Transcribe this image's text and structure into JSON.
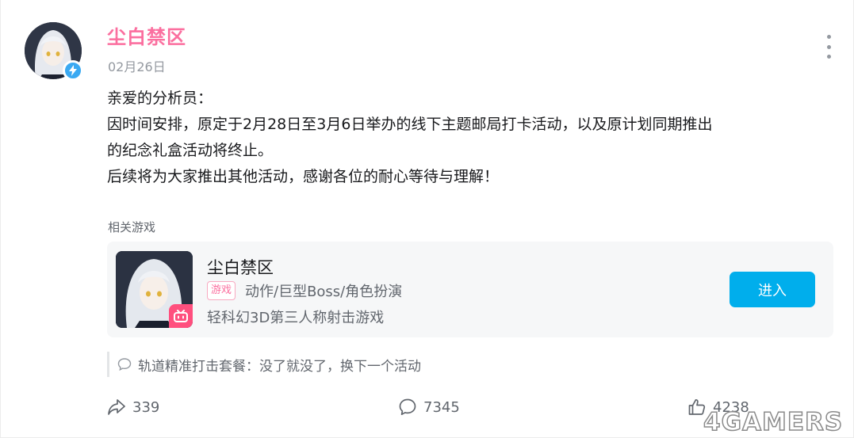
{
  "post": {
    "author": "尘白禁区",
    "date": "02月26日",
    "content_lines": [
      "亲爱的分析员：",
      "因时间安排，原定于2月28日至3月6日举办的线下主题邮局打卡活动，以及原计划同期推出",
      "的纪念礼盒活动将终止。",
      "后续将为大家推出其他活动，感谢各位的耐心等待与理解！"
    ]
  },
  "related": {
    "label": "相关游戏",
    "game": {
      "title": "尘白禁区",
      "tag": "游戏",
      "genre": "动作/巨型Boss/角色扮演",
      "description": "轻科幻3D第三人称射击游戏",
      "button": "进入"
    }
  },
  "top_reply": {
    "author": "轨道精准打击套餐",
    "separator": "：",
    "text": "没了就没了，换下一个活动"
  },
  "stats": {
    "forward": "339",
    "comment": "7345",
    "like": "4238"
  },
  "watermark": "4GAMERS",
  "icons": {
    "verified": "lightning-icon",
    "more": "more-vertical-icon",
    "forward": "forward-icon",
    "comment": "comment-icon",
    "like": "thumbs-up-icon",
    "reply": "comment-bubble-icon",
    "game_badge": "bilibili-tv-icon"
  },
  "colors": {
    "author": "#fb6f9f",
    "accent_button": "#00aeec",
    "verified": "#3aa9f2"
  }
}
